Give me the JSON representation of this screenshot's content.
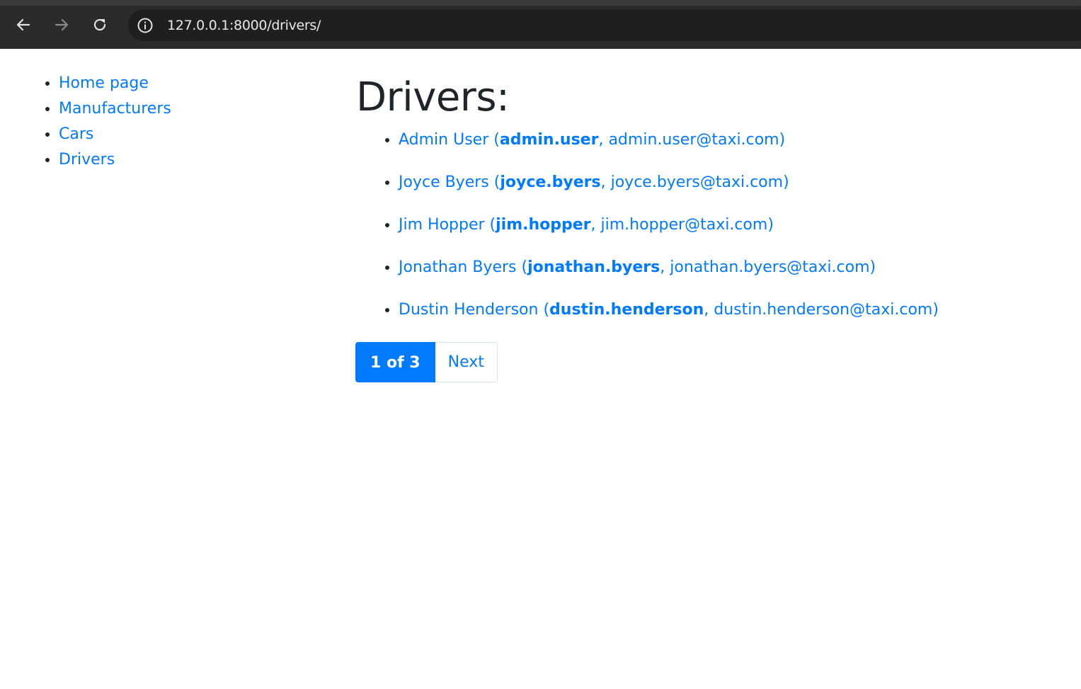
{
  "browser": {
    "url_host": "127.0.0.1:8000",
    "url_path": "/drivers/",
    "back_icon": "arrow-left-icon",
    "forward_icon": "arrow-right-icon",
    "reload_icon": "reload-icon",
    "info_icon": "info-icon"
  },
  "sidebar": {
    "items": [
      {
        "label": "Home page"
      },
      {
        "label": "Manufacturers"
      },
      {
        "label": "Cars"
      },
      {
        "label": "Drivers"
      }
    ]
  },
  "main": {
    "title": "Drivers:",
    "drivers": [
      {
        "name": "Admin User",
        "username": "admin.user",
        "email": "admin.user@taxi.com"
      },
      {
        "name": "Joyce Byers",
        "username": "joyce.byers",
        "email": "joyce.byers@taxi.com"
      },
      {
        "name": "Jim Hopper",
        "username": "jim.hopper",
        "email": "jim.hopper@taxi.com"
      },
      {
        "name": "Jonathan Byers",
        "username": "jonathan.byers",
        "email": "jonathan.byers@taxi.com"
      },
      {
        "name": "Dustin Henderson",
        "username": "dustin.henderson",
        "email": "dustin.henderson@taxi.com"
      }
    ]
  },
  "pagination": {
    "current": "1 of 3",
    "next_label": "Next"
  },
  "colors": {
    "link": "#007bff",
    "chrome_bg": "#2b2b2b",
    "urlbar_bg": "#1f1f1f"
  }
}
